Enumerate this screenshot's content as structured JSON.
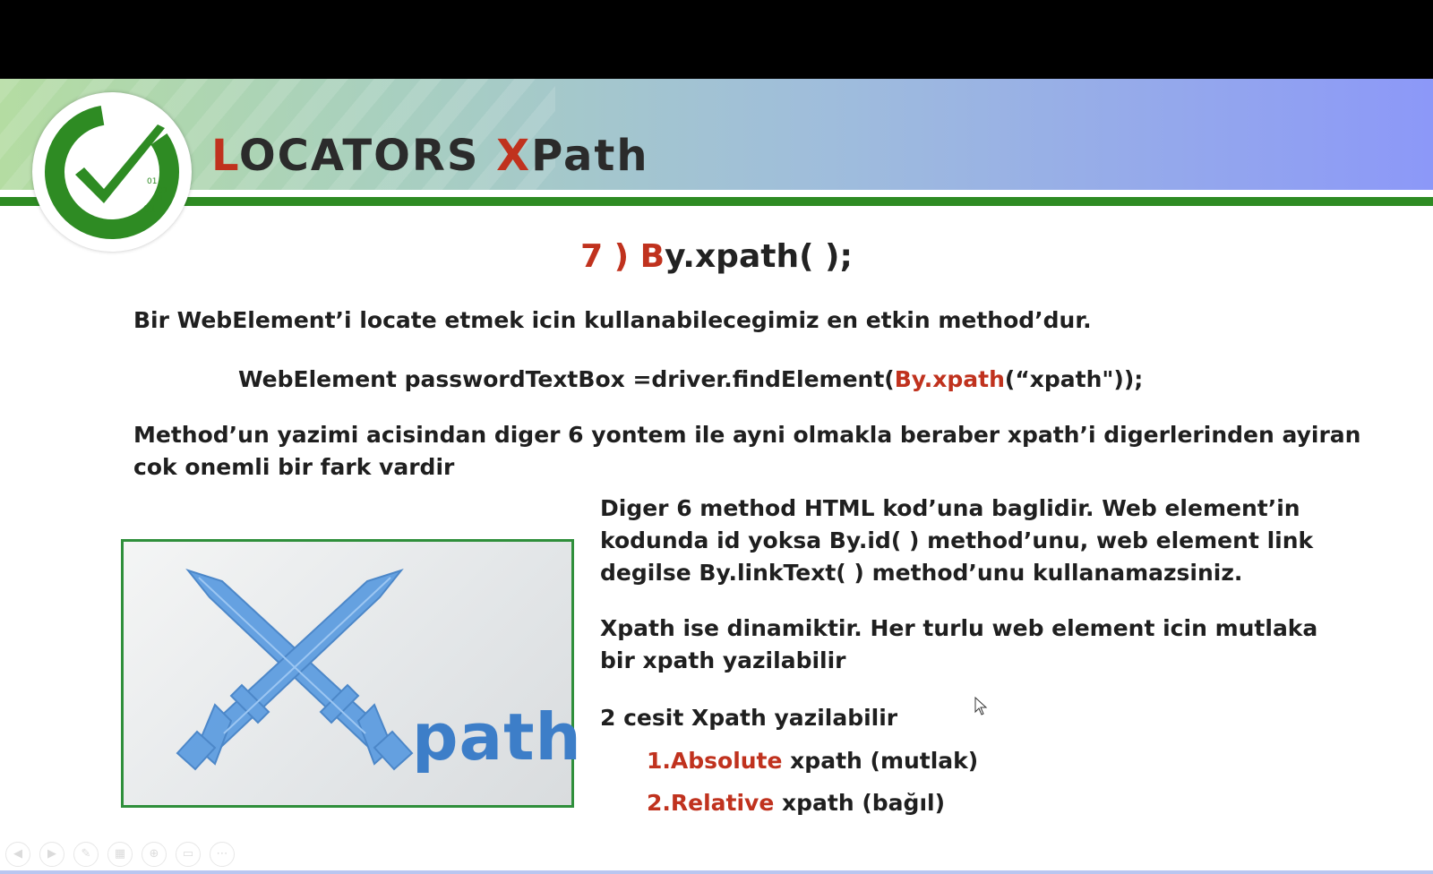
{
  "slide": {
    "title_first_letter": "L",
    "title_rest1": "OCATORS ",
    "title_second_letter": "X",
    "title_rest2": "Path",
    "subtitle_prefix": "7 ) B",
    "subtitle_rest": "y.xpath( );",
    "intro": "Bir WebElement’i locate etmek icin kullanabilecegimiz en etkin method’dur.",
    "code_prefix": "WebElement passwordTextBox =driver.findElement(",
    "code_highlight": "By.xpath",
    "code_suffix": "(“xpath\"));",
    "para2_line1": "Method’un yazimi acisindan diger 6 yontem ile ayni olmakla beraber xpath’i digerlerinden ayiran",
    "para2_line2": "cok onemli bir fark vardir",
    "right1_line1": "Diger 6 method HTML kod’una baglidir. Web element’in",
    "right1_line2": "kodunda id yoksa By.id( ) method’unu, web element link",
    "right1_line3": "degilse By.linkText( ) method’unu kullanamazsiniz.",
    "right2_line1": "Xpath ise dinamiktir. Her turlu web element icin mutlaka",
    "right2_line2": "bir xpath yazilabilir",
    "right3": "2 cesit Xpath yazilabilir",
    "item1_highlight": "1.Absolute",
    "item1_rest": " xpath (mutlak)",
    "item2_highlight": "2.Relative",
    "item2_rest": " xpath (bağıl)",
    "image_word": "path",
    "logo_binary": [
      "01",
      "01",
      "01",
      "01"
    ]
  },
  "colors": {
    "accent_red": "#c0321e",
    "brand_green": "#2e8b23",
    "xpath_blue": "#3d7ec8"
  },
  "icons": [
    "check-logo-icon",
    "crossed-swords-icon",
    "mouse-cursor-icon"
  ]
}
